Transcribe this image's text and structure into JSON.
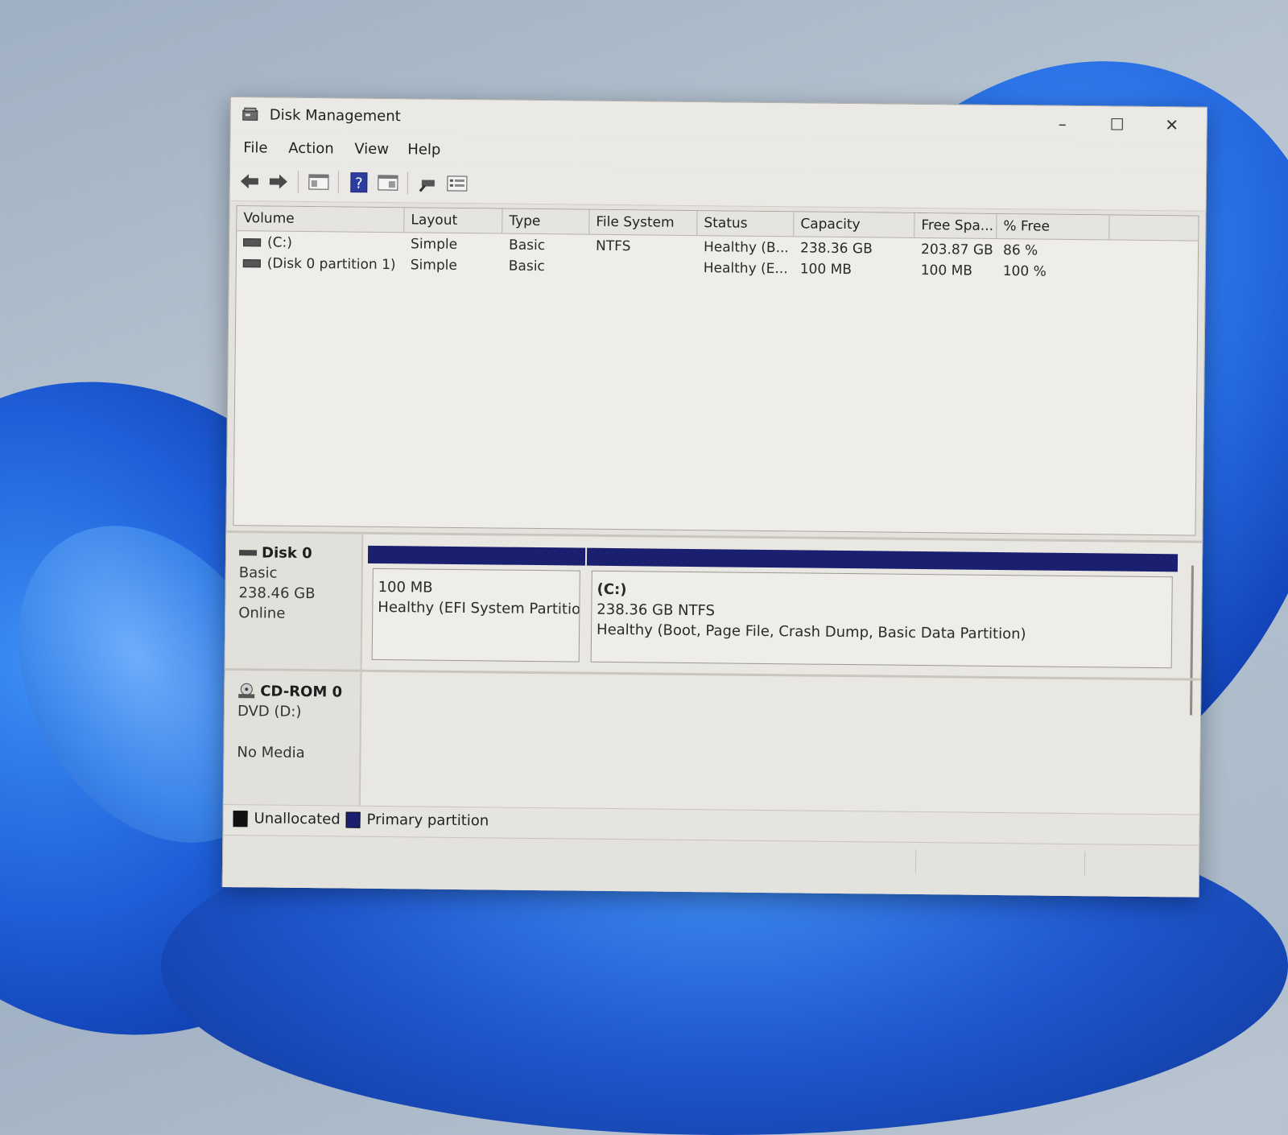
{
  "colors": {
    "primary_partition": "#1b1f6f",
    "unallocated": "#111111"
  },
  "window": {
    "title": "Disk Management",
    "icons": [
      "disk-management-app-icon",
      "minimize-icon",
      "maximize-icon",
      "close-icon"
    ]
  },
  "menu": {
    "items": [
      "File",
      "Action",
      "View",
      "Help"
    ]
  },
  "toolbar": {
    "icons": [
      "back-arrow-icon",
      "forward-arrow-icon",
      "console-tree-icon",
      "help-icon",
      "action-pane-icon",
      "rescan-icon",
      "properties-icon"
    ]
  },
  "volume_list": {
    "columns": [
      "Volume",
      "Layout",
      "Type",
      "File System",
      "Status",
      "Capacity",
      "Free Spa...",
      "% Free"
    ],
    "rows": [
      {
        "volume": "(C:)",
        "layout": "Simple",
        "type": "Basic",
        "fs": "NTFS",
        "status": "Healthy (B...",
        "capacity": "238.36 GB",
        "free": "203.87 GB",
        "pct_free": "86 %"
      },
      {
        "volume": "(Disk 0 partition 1)",
        "layout": "Simple",
        "type": "Basic",
        "fs": "",
        "status": "Healthy (E...",
        "capacity": "100 MB",
        "free": "100 MB",
        "pct_free": "100 %"
      }
    ]
  },
  "disks": [
    {
      "name": "Disk 0",
      "type": "Basic",
      "size": "238.46 GB",
      "state": "Online",
      "partitions": [
        {
          "label": "",
          "size": "100 MB",
          "status": "Healthy (EFI System Partition"
        },
        {
          "label": "(C:)",
          "size": "238.36 GB NTFS",
          "status": "Healthy (Boot, Page File, Crash Dump, Basic Data Partition)"
        }
      ]
    },
    {
      "name": "CD-ROM 0",
      "type": "DVD (D:)",
      "size": "",
      "state": "No Media"
    }
  ],
  "legend": {
    "items": [
      {
        "label": "Unallocated"
      },
      {
        "label": "Primary partition"
      }
    ]
  }
}
